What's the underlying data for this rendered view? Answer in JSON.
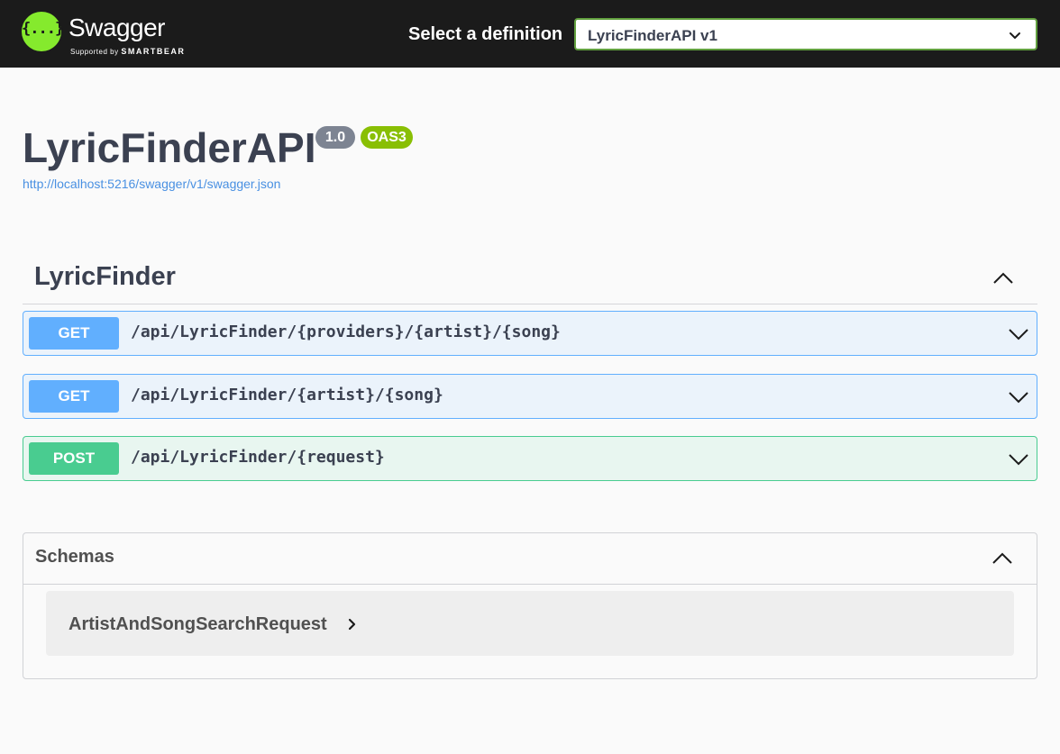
{
  "topbar": {
    "logo_glyph": "{...}",
    "logo_word": "Swagger",
    "logo_supported": "Supported by",
    "logo_brand": "SMARTBEAR",
    "definition_label": "Select a definition",
    "definition_selected": "LyricFinderAPI v1"
  },
  "info": {
    "title": "LyricFinderAPI",
    "version": "1.0",
    "oas_badge": "OAS3",
    "spec_url": "http://localhost:5216/swagger/v1/swagger.json"
  },
  "tag": {
    "name": "LyricFinder",
    "operations": [
      {
        "method": "GET",
        "path": "/api/LyricFinder/{providers}/{artist}/{song}"
      },
      {
        "method": "GET",
        "path": "/api/LyricFinder/{artist}/{song}"
      },
      {
        "method": "POST",
        "path": "/api/LyricFinder/{request}"
      }
    ]
  },
  "schemas": {
    "title": "Schemas",
    "models": [
      {
        "name": "ArtistAndSongSearchRequest"
      }
    ]
  },
  "colors": {
    "topbar_bg": "#1b1b1b",
    "logo_green": "#85ea2d",
    "get": "#61affe",
    "post": "#49cc90",
    "version_badge": "#7d8492",
    "oas_badge": "#89bf04",
    "link": "#4990e2"
  },
  "icons": {
    "definition_select": "chevron-down-icon",
    "tag_toggle": "chevron-up-icon",
    "operation_expand": "chevron-down-icon",
    "schemas_toggle": "chevron-up-icon",
    "model_expand": "chevron-right-icon"
  }
}
